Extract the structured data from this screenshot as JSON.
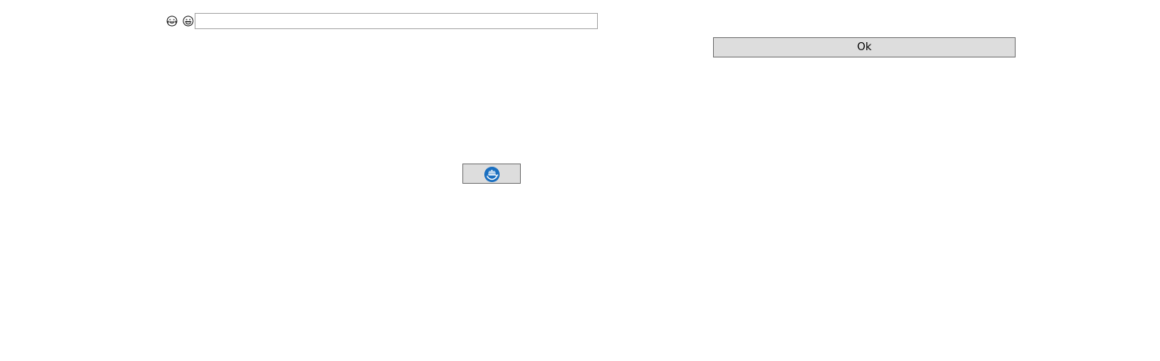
{
  "emojis": [
    {
      "icon": "laughing-tears-face-icon"
    },
    {
      "icon": "grinning-face-icon"
    }
  ],
  "text_field": {
    "value": "",
    "placeholder": ""
  },
  "ok_button": {
    "label": "Ok"
  },
  "icon_button": {
    "icon": "ship-refresh-icon",
    "accent_color": "#1a6fc0"
  }
}
